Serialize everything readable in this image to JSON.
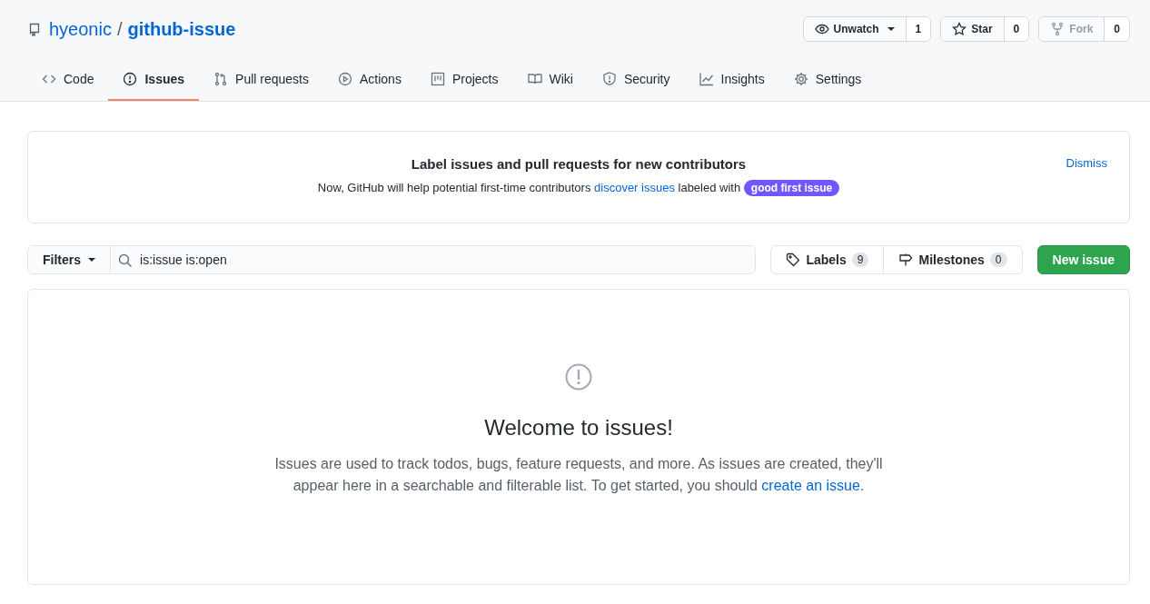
{
  "repo": {
    "owner": "hyeonic",
    "separator": "/",
    "name": "github-issue"
  },
  "repo_actions": [
    {
      "label": "Unwatch",
      "count": "1",
      "dropdown": true,
      "disabled": false
    },
    {
      "label": "Star",
      "count": "0",
      "dropdown": false,
      "disabled": false
    },
    {
      "label": "Fork",
      "count": "0",
      "dropdown": false,
      "disabled": true
    }
  ],
  "tabs": [
    {
      "label": "Code",
      "selected": false
    },
    {
      "label": "Issues",
      "selected": true
    },
    {
      "label": "Pull requests",
      "selected": false
    },
    {
      "label": "Actions",
      "selected": false
    },
    {
      "label": "Projects",
      "selected": false
    },
    {
      "label": "Wiki",
      "selected": false
    },
    {
      "label": "Security",
      "selected": false
    },
    {
      "label": "Insights",
      "selected": false
    },
    {
      "label": "Settings",
      "selected": false
    }
  ],
  "banner": {
    "title": "Label issues and pull requests for new contributors",
    "text_before": "Now, GitHub will help potential first-time contributors",
    "link": "discover issues",
    "text_after": "labeled with",
    "label": "good first issue",
    "dismiss": "Dismiss"
  },
  "filters": {
    "button": "Filters",
    "search_value": "is:issue is:open"
  },
  "nav_buttons": [
    {
      "label": "Labels",
      "count": "9"
    },
    {
      "label": "Milestones",
      "count": "0"
    }
  ],
  "new_issue": "New issue",
  "blankslate": {
    "title": "Welcome to issues!",
    "text": "Issues are used to track todos, bugs, feature requests, and more. As issues are created, they'll appear here in a searchable and filterable list. To get started, you should",
    "link": "create an issue",
    "end": "."
  }
}
